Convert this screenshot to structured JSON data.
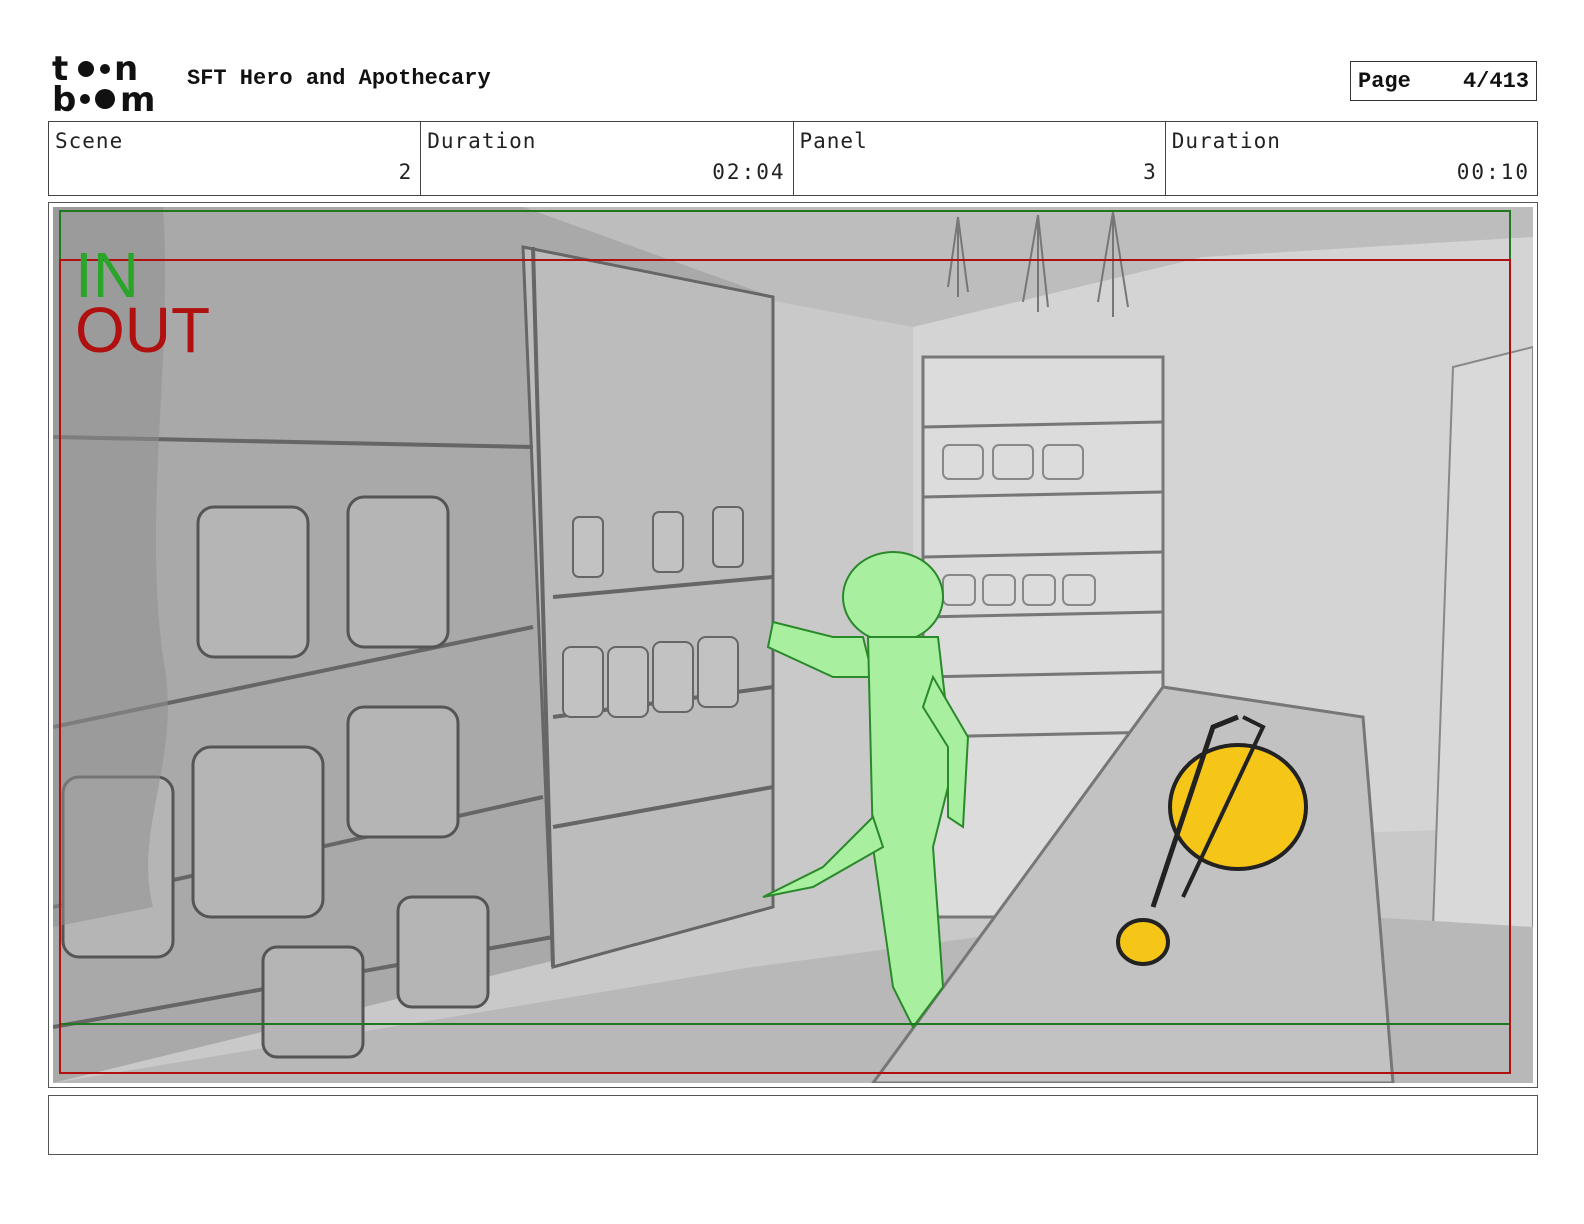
{
  "header": {
    "logo_top": "to•n",
    "logo_bottom": "b••m",
    "project_title": "SFT Hero and Apothecary",
    "page_label": "Page",
    "page_value": "4/413"
  },
  "info": {
    "scene_label": "Scene",
    "scene_value": "2",
    "scene_duration_label": "Duration",
    "scene_duration_value": "02:04",
    "panel_label": "Panel",
    "panel_value": "3",
    "panel_duration_label": "Duration",
    "panel_duration_value": "00:10"
  },
  "panel": {
    "in_label": "IN",
    "out_label": "OUT",
    "colors": {
      "in_frame": "#1f7a1f",
      "out_frame": "#b01010",
      "character": "#a8f0a0",
      "potion": "#f5c518"
    }
  },
  "notes": {
    "text": ""
  }
}
